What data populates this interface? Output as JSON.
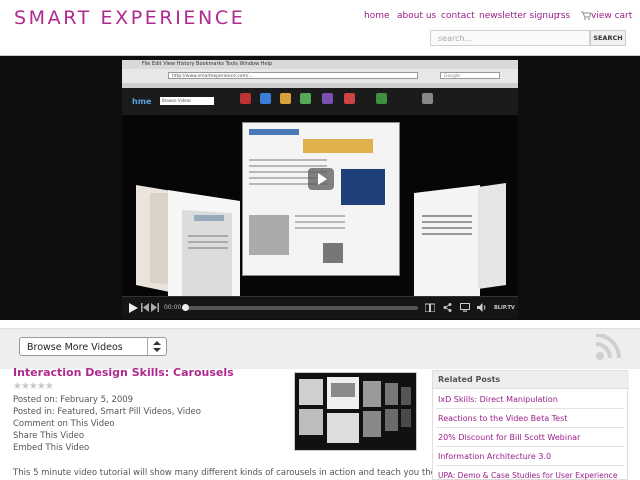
{
  "header": {
    "logo": "SMART EXPERIENCE",
    "nav": [
      "home",
      "about us",
      "contact",
      "newsletter signup",
      "rss",
      "view cart"
    ],
    "search_placeholder": "search...",
    "search_button": "SEARCH"
  },
  "player": {
    "browser_menu": "File Edit View History Bookmarks Tools Window Help",
    "browser_url": "http://www.smartexperience.com/...",
    "search_engine_box": "Google",
    "site_logo": "hme",
    "site_search": "Browse Videos",
    "time": "00:00",
    "brand": "BLIP.TV",
    "progress": 0
  },
  "browse": {
    "select_value": "Browse More Videos"
  },
  "post": {
    "title": "Interaction Design Skills: Carousels",
    "stars": "★★★★★",
    "posted_on": "Posted on: February 5, 2009",
    "posted_in": "Posted in: Featured, Smart Pill Videos, Video",
    "comment": "Comment on This Video",
    "share": "Share This Video",
    "embed": "Embed This Video",
    "description": "This 5 minute video tutorial will show many different kinds of carousels in action and teach you the three key"
  },
  "sidebar": {
    "heading": "Related Posts",
    "links": [
      "IxD Skills: Direct Manipulation",
      "Reactions to the Video Beta Test",
      "20% Discount for Bill Scott Webinar",
      "Information Architecture 3.0",
      "UPA: Demo & Case Studies for User Experience"
    ]
  },
  "colors": {
    "brand": "#b02a8e",
    "link": "#9b1e8a"
  }
}
